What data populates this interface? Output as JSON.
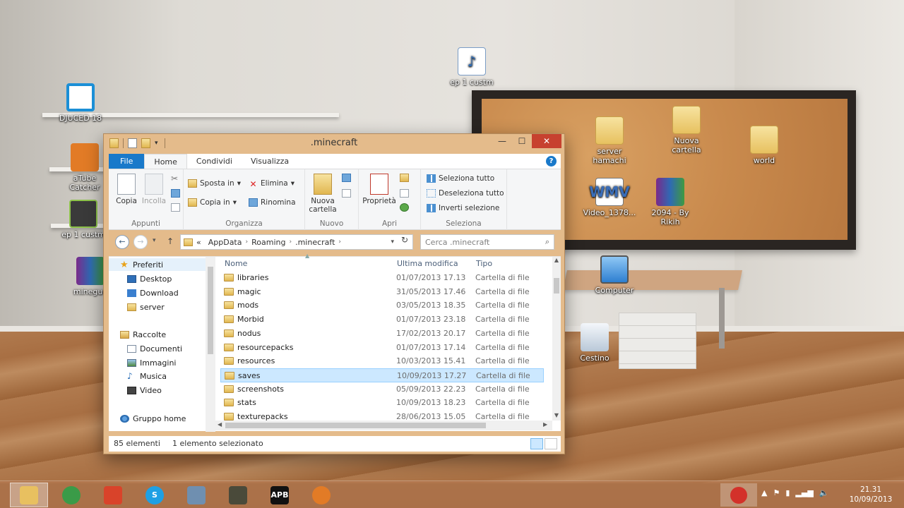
{
  "desktop": {
    "icons": [
      {
        "label": "DJUCED 18"
      },
      {
        "label": "aTube Catcher"
      },
      {
        "label": "ep 1 custm"
      },
      {
        "label": "mineguo"
      },
      {
        "label": "ep 1 custm"
      },
      {
        "label": "server hamachi"
      },
      {
        "label": "Nuova cartella"
      },
      {
        "label": "world"
      },
      {
        "label": "Video_1378..."
      },
      {
        "label": "2094 - By Rikih"
      },
      {
        "label": "Computer"
      },
      {
        "label": "Cestino"
      }
    ],
    "wmv_badge": "WMV"
  },
  "window": {
    "title": ".minecraft",
    "controls": {
      "minimize": "—",
      "maximize": "☐",
      "close": "✕"
    },
    "tabs": [
      "File",
      "Home",
      "Condividi",
      "Visualizza"
    ],
    "help": "?",
    "ribbon": {
      "groups": [
        "Appunti",
        "Organizza",
        "Nuovo",
        "Apri",
        "Seleziona"
      ],
      "copia": "Copia",
      "incolla": "Incolla",
      "sposta_in": "Sposta in",
      "copia_in": "Copia in",
      "elimina": "Elimina",
      "rinomina": "Rinomina",
      "nuova_cartella": "Nuova cartella",
      "proprieta": "Proprietà",
      "seleziona_tutto": "Seleziona tutto",
      "deseleziona_tutto": "Deseleziona tutto",
      "inverti_selezione": "Inverti selezione"
    },
    "address": {
      "prefix": "«",
      "crumbs": [
        "AppData",
        "Roaming",
        ".minecraft"
      ],
      "search_placeholder": "Cerca .minecraft"
    },
    "nav": [
      {
        "label": "Preferiti",
        "icon": "star-icon",
        "indent": 0,
        "selected": true
      },
      {
        "label": "Desktop",
        "icon": "desktop-icon",
        "indent": 1
      },
      {
        "label": "Download",
        "icon": "download-icon",
        "indent": 1
      },
      {
        "label": "server",
        "icon": "folder-icon",
        "indent": 1
      },
      {
        "label": "Raccolte",
        "icon": "library-icon",
        "indent": 0
      },
      {
        "label": "Documenti",
        "icon": "documents-icon",
        "indent": 1
      },
      {
        "label": "Immagini",
        "icon": "pictures-icon",
        "indent": 1
      },
      {
        "label": "Musica",
        "icon": "music-icon",
        "indent": 1
      },
      {
        "label": "Video",
        "icon": "video-icon",
        "indent": 1
      },
      {
        "label": "Gruppo home",
        "icon": "homegroup-icon",
        "indent": 0
      }
    ],
    "columns": {
      "name": "Nome",
      "date": "Ultima modifica",
      "type": "Tipo"
    },
    "files": [
      {
        "name": "libraries",
        "date": "01/07/2013 17.13",
        "type": "Cartella di file"
      },
      {
        "name": "magic",
        "date": "31/05/2013 17.46",
        "type": "Cartella di file"
      },
      {
        "name": "mods",
        "date": "03/05/2013 18.35",
        "type": "Cartella di file"
      },
      {
        "name": "Morbid",
        "date": "01/07/2013 23.18",
        "type": "Cartella di file"
      },
      {
        "name": "nodus",
        "date": "17/02/2013 20.17",
        "type": "Cartella di file"
      },
      {
        "name": "resourcepacks",
        "date": "01/07/2013 17.14",
        "type": "Cartella di file"
      },
      {
        "name": "resources",
        "date": "10/03/2013 15.41",
        "type": "Cartella di file"
      },
      {
        "name": "saves",
        "date": "10/09/2013 17.27",
        "type": "Cartella di file",
        "selected": true
      },
      {
        "name": "screenshots",
        "date": "05/09/2013 22.23",
        "type": "Cartella di file"
      },
      {
        "name": "stats",
        "date": "10/09/2013 18.23",
        "type": "Cartella di file"
      },
      {
        "name": "texturepacks",
        "date": "28/06/2013 15.05",
        "type": "Cartella di file"
      }
    ],
    "status": {
      "count": "85 elementi",
      "selection": "1 elemento selezionato"
    }
  },
  "taskbar": {
    "apps": [
      {
        "name": "file-explorer",
        "active": true,
        "color": "#e8c060"
      },
      {
        "name": "chrome",
        "color": "#3a9b48"
      },
      {
        "name": "office",
        "color": "#d9432a"
      },
      {
        "name": "skype",
        "color": "#1ea0e4",
        "text": "S"
      },
      {
        "name": "app-window",
        "color": "#6f8fb0"
      },
      {
        "name": "minecraft-launcher",
        "color": "#4a4a3a"
      },
      {
        "name": "apb",
        "color": "#111111",
        "text": "APB"
      },
      {
        "name": "atube-catcher",
        "color": "#e27b26"
      }
    ],
    "clock": {
      "time": "21.31",
      "date": "10/09/2013"
    }
  }
}
